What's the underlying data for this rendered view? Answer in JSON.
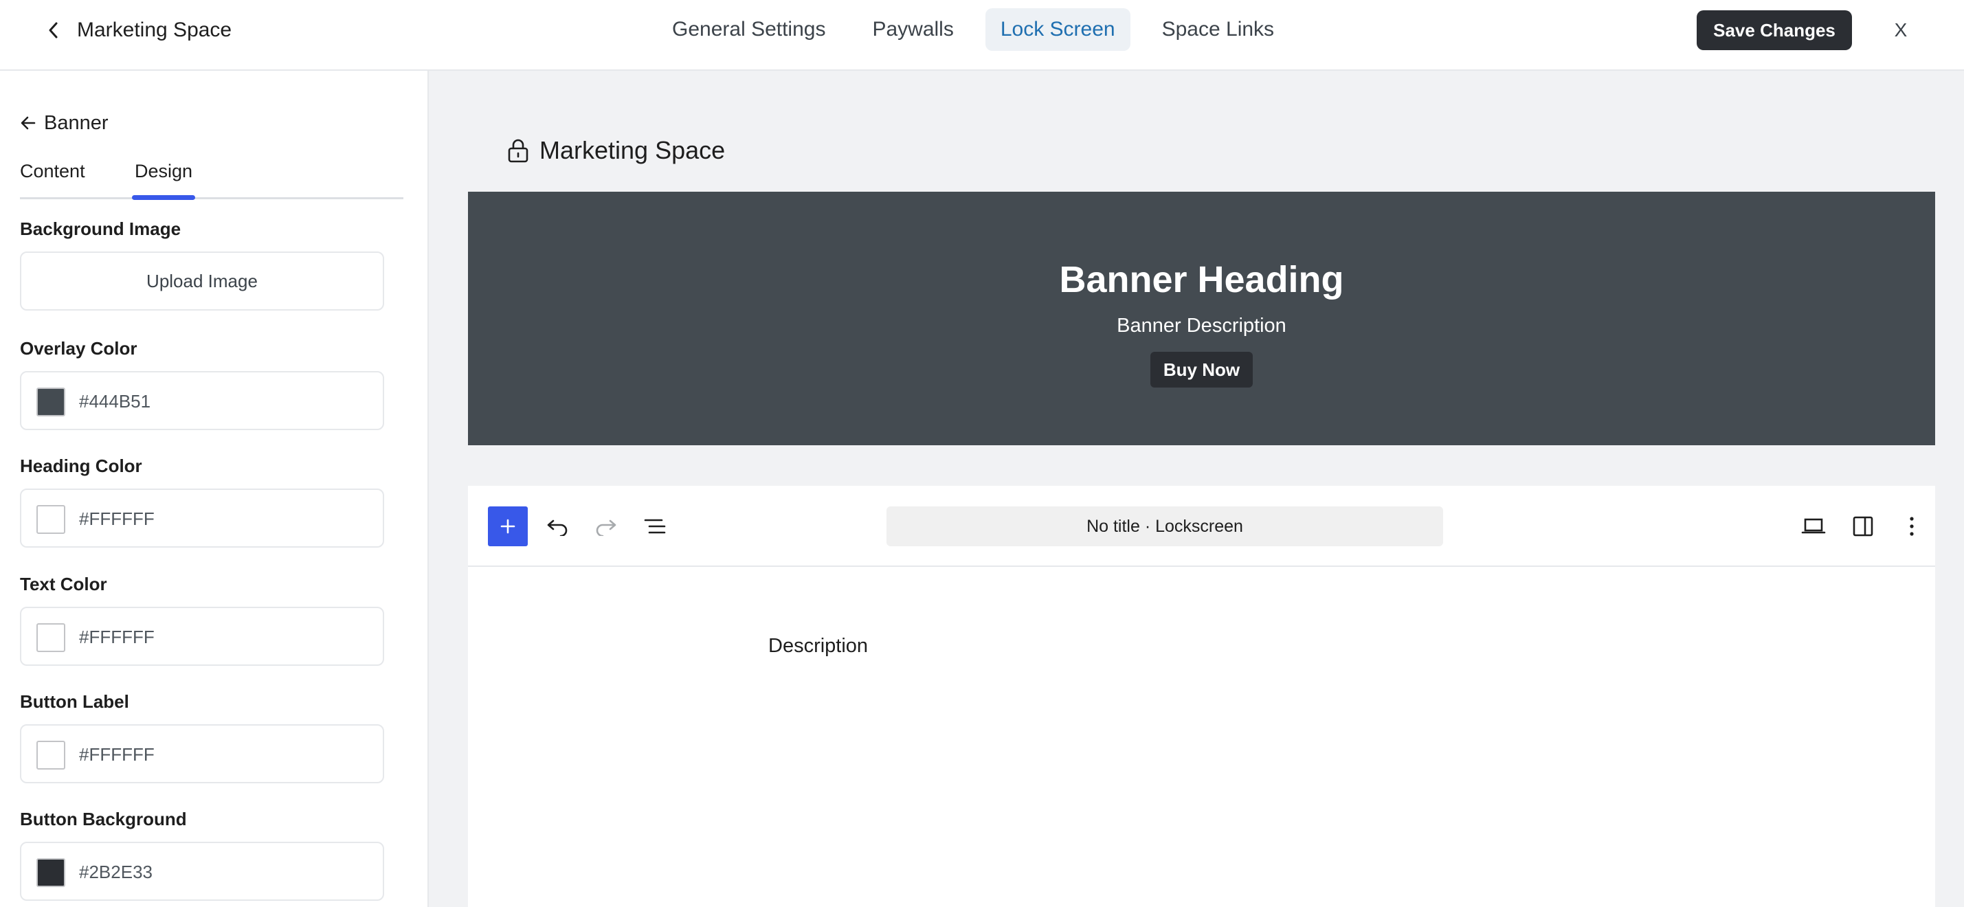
{
  "header": {
    "title": "Marketing Space",
    "tabs": [
      {
        "label": "General Settings",
        "active": false
      },
      {
        "label": "Paywalls",
        "active": false
      },
      {
        "label": "Lock Screen",
        "active": true
      },
      {
        "label": "Space Links",
        "active": false
      }
    ],
    "save_label": "Save Changes",
    "close_label": "X"
  },
  "sidebar": {
    "back_label": "Banner",
    "tabs": [
      {
        "label": "Content",
        "active": false
      },
      {
        "label": "Design",
        "active": true
      }
    ],
    "background_image": {
      "label": "Background Image",
      "upload_label": "Upload Image"
    },
    "fields": [
      {
        "label": "Overlay Color",
        "value": "#444B51",
        "swatch": "#444b51"
      },
      {
        "label": "Heading Color",
        "value": "#FFFFFF",
        "swatch": "#ffffff"
      },
      {
        "label": "Text Color",
        "value": "#FFFFFF",
        "swatch": "#ffffff"
      },
      {
        "label": "Button Label",
        "value": "#FFFFFF",
        "swatch": "#ffffff"
      },
      {
        "label": "Button Background",
        "value": "#2B2E33",
        "swatch": "#2b2e33"
      }
    ]
  },
  "preview": {
    "space_title": "Marketing Space",
    "banner": {
      "heading": "Banner Heading",
      "description": "Banner Description",
      "button_label": "Buy Now",
      "background": "#444b51"
    },
    "editor": {
      "doc_title": "No title · Lockscreen",
      "body_text": "Description"
    }
  },
  "colors": {
    "accent": "#3858e9",
    "active_tab_text": "#1f6fb0",
    "dark_button": "#2b2e33"
  }
}
